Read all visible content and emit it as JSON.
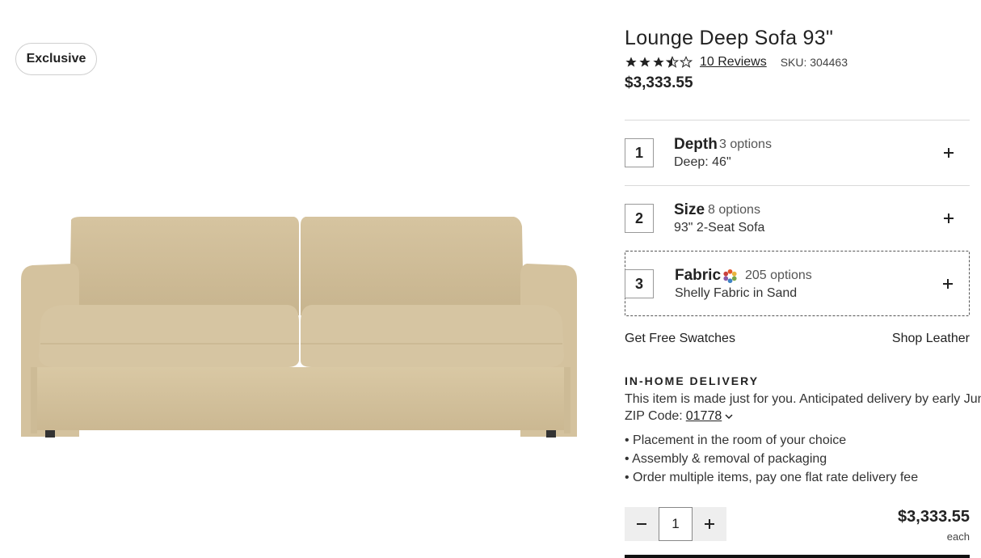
{
  "badge": "Exclusive",
  "product": {
    "title": "Lounge Deep Sofa 93\"",
    "rating": 3.5,
    "reviews_label": "10 Reviews",
    "sku_label": "SKU: 304463",
    "price": "$3,333.55"
  },
  "options": [
    {
      "num": "1",
      "name": "Depth",
      "count": "3 options",
      "value": "Deep: 46\""
    },
    {
      "num": "2",
      "name": "Size",
      "count": "8 options",
      "value": "93\" 2-Seat Sofa"
    },
    {
      "num": "3",
      "name": "Fabric",
      "count": "205 options",
      "value": "Shelly Fabric in Sand"
    }
  ],
  "links": {
    "swatches": "Get Free Swatches",
    "leather": "Shop Leather"
  },
  "delivery": {
    "heading": "IN-HOME DELIVERY",
    "text": "This item is made just for you. Anticipated delivery by early June.",
    "zip_label": "ZIP Code:",
    "zip_value": "01778",
    "bullets": [
      "• Placement in the room of your choice",
      "• Assembly & removal of packaging",
      "• Order multiple items, pay one flat rate delivery fee"
    ]
  },
  "quantity": {
    "value": "1"
  },
  "price_bottom": "$3,333.55",
  "each_label": "each",
  "colors": {
    "sofa": "#d3c09a",
    "sofa_shadow": "#b9a57f",
    "text": "#222222",
    "border": "#d9d9d9"
  }
}
